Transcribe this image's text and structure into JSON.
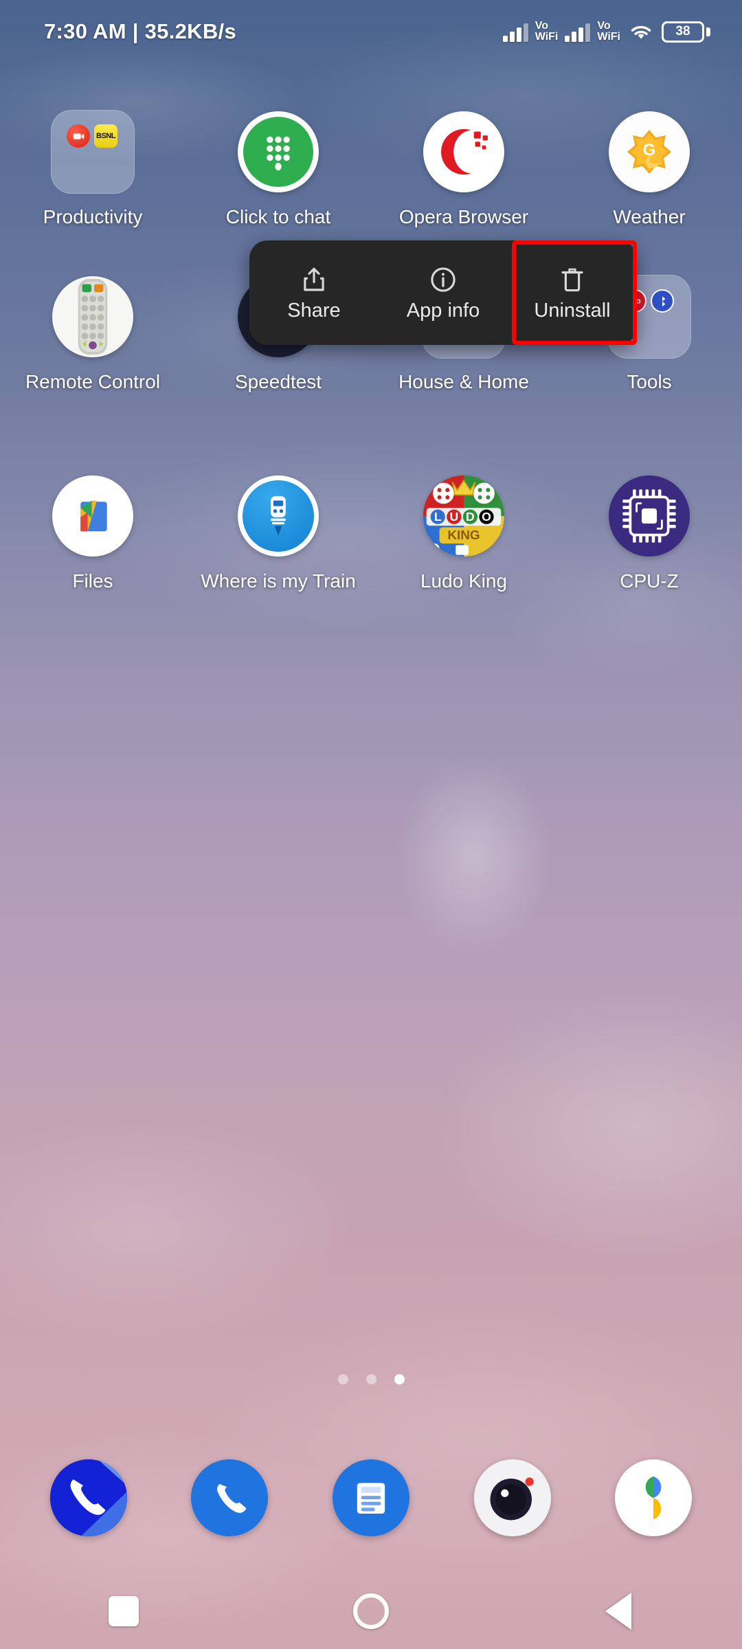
{
  "status_bar": {
    "left_text": "7:30 AM | 35.2KB/s",
    "sim1_label_top": "Vo",
    "sim1_label_bottom": "WiFi",
    "sim2_label_top": "Vo",
    "sim2_label_bottom": "WiFi",
    "battery_level": "38"
  },
  "context_menu": {
    "items": [
      {
        "label": "Share",
        "icon": "share-icon"
      },
      {
        "label": "App info",
        "icon": "info-circle-icon"
      },
      {
        "label": "Uninstall",
        "icon": "trash-icon"
      }
    ],
    "highlight_color": "#ff0000",
    "background_color": "#262626"
  },
  "home_grid": {
    "rows": [
      {
        "apps": [
          {
            "label": "Productivity",
            "type": "folder"
          },
          {
            "label": "Click to chat",
            "type": "app"
          },
          {
            "label": "Opera Browser",
            "type": "app"
          },
          {
            "label": "Weather",
            "type": "app"
          }
        ]
      },
      {
        "apps": [
          {
            "label": "Remote Control",
            "type": "app"
          },
          {
            "label": "Speedtest",
            "type": "app"
          },
          {
            "label": "House & Home",
            "type": "folder"
          },
          {
            "label": "Tools",
            "type": "folder"
          }
        ]
      },
      {
        "apps": [
          {
            "label": "Files",
            "type": "app"
          },
          {
            "label": "Where is my Train",
            "type": "app"
          },
          {
            "label": "Ludo King",
            "type": "app"
          },
          {
            "label": "CPU-Z",
            "type": "app"
          }
        ]
      }
    ]
  },
  "page_indicator": {
    "count": 3,
    "active_index": 2
  },
  "dock": {
    "items": [
      {
        "name": "dialer-icon"
      },
      {
        "name": "phone-icon"
      },
      {
        "name": "messages-icon"
      },
      {
        "name": "camera-icon"
      },
      {
        "name": "google-photos-icon"
      }
    ]
  },
  "nav_bar": {
    "recents_label": "Recents",
    "home_label": "Home",
    "back_label": "Back"
  }
}
